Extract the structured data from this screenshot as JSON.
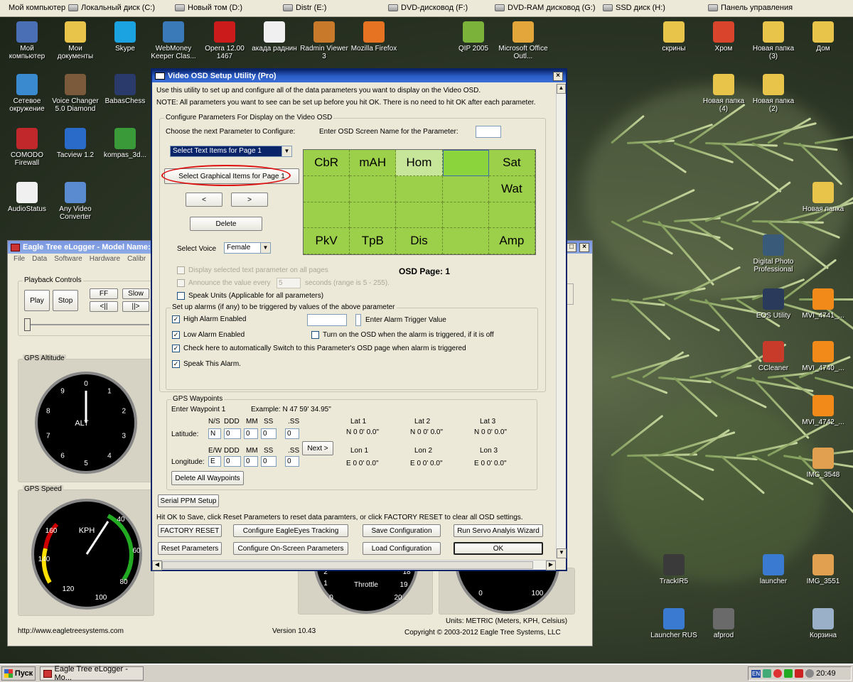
{
  "drivebar": {
    "items": [
      "Мой компьютер",
      "Локальный диск (C:)",
      "Новый том (D:)",
      "Distr (E:)",
      "DVD-дисковод (F:)",
      "DVD-RAM дисковод (G:)",
      "SSD диск (H:)",
      "Панель управления"
    ]
  },
  "desktop": {
    "icons": [
      {
        "label": "Мой компьютер",
        "icon": "computer-icon"
      },
      {
        "label": "Мои документы",
        "icon": "folder-icon"
      },
      {
        "label": "Skype",
        "icon": "skype-icon"
      },
      {
        "label": "WebMoney Keeper Clas...",
        "icon": "webmoney-icon"
      },
      {
        "label": "Opera 12.00 1467",
        "icon": "opera-icon"
      },
      {
        "label": "акада раднин",
        "icon": "document-icon"
      },
      {
        "label": "Radmin Viewer 3",
        "icon": "radmin-icon"
      },
      {
        "label": "Mozilla Firefox",
        "icon": "firefox-icon"
      },
      {
        "label": "QIP 2005",
        "icon": "qip-icon"
      },
      {
        "label": "Microsoft Office Outl...",
        "icon": "outlook-icon"
      },
      {
        "label": "скрины",
        "icon": "folder-icon"
      },
      {
        "label": "Хром",
        "icon": "chrome-icon"
      },
      {
        "label": "Новая папка (3)",
        "icon": "folder-icon"
      },
      {
        "label": "Дом",
        "icon": "folder-icon"
      },
      {
        "label": "Сетевое окружение",
        "icon": "network-icon"
      },
      {
        "label": "Voice Changer 5.0 Diamond",
        "icon": "voice-changer-icon"
      },
      {
        "label": "BabasChess",
        "icon": "chess-icon"
      },
      {
        "label": "Новая папка (4)",
        "icon": "folder-icon"
      },
      {
        "label": "Новая папка (2)",
        "icon": "folder-icon"
      },
      {
        "label": "COMODO Firewall",
        "icon": "comodo-icon"
      },
      {
        "label": "Tacview 1.2",
        "icon": "tacview-icon"
      },
      {
        "label": "kompas_3d...",
        "icon": "utorrent-icon"
      },
      {
        "label": "AudioStatus",
        "icon": "document-icon"
      },
      {
        "label": "Any Video Converter",
        "icon": "video-converter-icon"
      },
      {
        "label": "Новая папка",
        "icon": "folder-icon"
      },
      {
        "label": "Digital Photo Professional",
        "icon": "photo-icon"
      },
      {
        "label": "EOS Utility",
        "icon": "eos-icon"
      },
      {
        "label": "MVI_4741_...",
        "icon": "vlc-icon"
      },
      {
        "label": "CCleaner",
        "icon": "ccleaner-icon"
      },
      {
        "label": "MVI_4740_...",
        "icon": "vlc-icon"
      },
      {
        "label": "MVI_4742_...",
        "icon": "vlc-icon"
      },
      {
        "label": "IMG_3548",
        "icon": "image-icon"
      },
      {
        "label": "TrackIR5",
        "icon": "trackir-icon"
      },
      {
        "label": "launcher",
        "icon": "launcher-icon"
      },
      {
        "label": "IMG_3551",
        "icon": "image-icon"
      },
      {
        "label": "Launcher RUS",
        "icon": "launcher-icon"
      },
      {
        "label": "afprod",
        "icon": "afprod-icon"
      },
      {
        "label": "Корзина",
        "icon": "recycle-bin-icon"
      }
    ]
  },
  "logger": {
    "title": "Eagle Tree eLogger - Model Name:",
    "menu": [
      "File",
      "Data",
      "Software",
      "Hardware",
      "Calibr"
    ],
    "playback": {
      "label": "Playback Controls",
      "play": "Play",
      "stop": "Stop",
      "ff": "FF",
      "slow": "Slow",
      "prev": "<||",
      "next": "||>"
    },
    "gps_altitude": {
      "label": "GPS Altitude",
      "dial_label": "ALT",
      "ticks": [
        "0",
        "1",
        "2",
        "3",
        "4",
        "5",
        "6",
        "7",
        "8",
        "9"
      ]
    },
    "gps_speed": {
      "label": "GPS Speed",
      "unit": "KPH",
      "ticks": [
        "40",
        "60",
        "80",
        "100",
        "120",
        "140",
        "160"
      ]
    },
    "throttle": {
      "label": "Throttle",
      "ticks": [
        "2",
        "1",
        "0",
        "18",
        "19",
        "20"
      ]
    },
    "right_gauge": {
      "ticks": [
        "0",
        "100"
      ]
    },
    "url": "http://www.eagletreesystems.com",
    "version": "Version 10.43",
    "units": "Units: METRIC (Meters, KPH, Celsius)",
    "copyright": "Copyright © 2003-2012 Eagle Tree Systems, LLC"
  },
  "osd": {
    "title": "Video OSD Setup Utility (Pro)",
    "intro1": "Use this utility to set up and configure all of the data parameters you want to display on the Video OSD.",
    "intro2": "NOTE:  All parameters you want to see can be set up before you hit OK. There is no need to hit OK after each parameter.",
    "configure_group": "Configure Parameters For Display on the Video OSD",
    "choose_next": "Choose the next Parameter to Configure:",
    "enter_screen_name": "Enter OSD Screen Name for the Parameter:",
    "text_items_select": "Select Text Items for Page 1",
    "graphical_items_btn": "Select Graphical Items for Page 1",
    "prev_btn": "<",
    "next_btn": ">",
    "delete_btn": "Delete",
    "select_voice": "Select Voice",
    "voice_value": "Female",
    "grid": [
      "CbR",
      "mAH",
      "Hom",
      "",
      "Sat",
      "",
      "",
      "",
      "",
      "Wat",
      "",
      "",
      "",
      "",
      "",
      "PkV",
      "TpB",
      "Dis",
      "",
      "Amp"
    ],
    "display_all_pages": "Display selected text parameter on all pages",
    "announce_every": "Announce the value every",
    "announce_seconds": "5",
    "announce_range": "seconds (range is 5 - 255).",
    "speak_units": "Speak Units (Applicable for all parameters)",
    "osd_page": "OSD Page: 1",
    "alarms": {
      "group": "Set up alarms (if any) to be triggered by values of the above parameter",
      "high": "High Alarm Enabled",
      "low": "Low Alarm Enabled",
      "trigger_value": "Enter Alarm Trigger Value",
      "turn_on": "Turn on the OSD when the alarm is triggered, if it is off",
      "auto_switch": "Check here to automatically Switch to this Parameter's OSD page when alarm is triggered",
      "speak": "Speak This Alarm."
    },
    "waypoints": {
      "group": "GPS Waypoints",
      "enter": "Enter Waypoint 1",
      "example": "Example: N 47 59' 34.95\"",
      "lat_header": [
        "N/S",
        "DDD",
        "MM",
        "SS",
        ".SS"
      ],
      "lon_header": [
        "E/W",
        "DDD",
        "MM",
        "SS",
        ".SS"
      ],
      "latitude": "Latitude:",
      "longitude": "Longitude:",
      "lat_values": [
        "N",
        "0",
        "0",
        "0",
        "0"
      ],
      "lon_values": [
        "E",
        "0",
        "0",
        "0",
        "0"
      ],
      "next_btn": "Next >",
      "delete_all": "Delete All Waypoints",
      "lat1": "Lat 1",
      "lat2": "Lat 2",
      "lat3": "Lat 3",
      "lat1v": "N 0 0' 0.0\"",
      "lat2v": "N 0 0' 0.0\"",
      "lat3v": "N 0 0' 0.0\"",
      "lon1": "Lon 1",
      "lon2": "Lon 2",
      "lon3": "Lon 3",
      "lon1v": "E 0 0' 0.0\"",
      "lon2v": "E 0 0' 0.0\"",
      "lon3v": "E 0 0' 0.0\""
    },
    "serial_ppm": "Serial PPM Setup",
    "hint": "Hit OK to Save, click Reset Parameters to reset data paramters, or click FACTORY RESET to clear all OSD settings.",
    "factory_reset": "FACTORY RESET",
    "eagleeyes": "Configure EagleEyes Tracking",
    "save_config": "Save Configuration",
    "servo_wizard": "Run Servo Analyis Wizard",
    "reset_params": "Reset Parameters",
    "onscreen_params": "Configure On-Screen Parameters",
    "load_config": "Load Configuration",
    "ok": "OK"
  },
  "taskbar": {
    "start": "Пуск",
    "task": "Eagle Tree eLogger - Mo...",
    "lang": "EN",
    "time": "20:49"
  }
}
